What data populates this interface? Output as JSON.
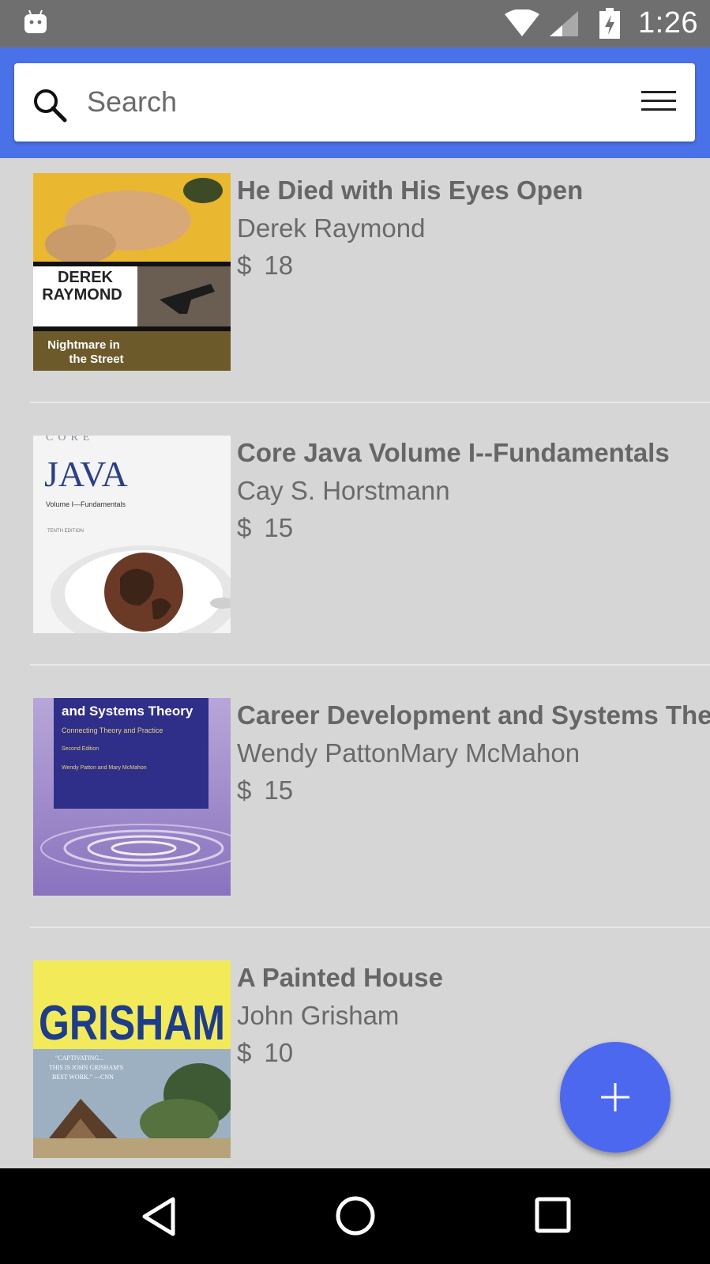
{
  "status_bar": {
    "time": "1:26",
    "icons": [
      "android-icon",
      "wifi-icon",
      "cell-signal-icon",
      "battery-charging-icon"
    ]
  },
  "search": {
    "placeholder": "Search",
    "value": ""
  },
  "books": [
    {
      "title": "He Died with His Eyes Open",
      "author": "Derek Raymond",
      "currency": "$",
      "price": "18",
      "cover": {
        "line1": "DEREK",
        "line2": "RAYMOND",
        "line3": "Nightmare in",
        "line4": "the Street"
      }
    },
    {
      "title": "Core Java Volume I--Fundamentals",
      "author": "Cay S. Horstmann",
      "currency": "$",
      "price": "15",
      "cover": {
        "line1": "CORE",
        "line2": "JAVA",
        "line3": "Volume I—Fundamentals",
        "line4": "TENTH EDITION"
      }
    },
    {
      "title": "Career Development and Systems Theory",
      "author": "Wendy PattonMary McMahon",
      "currency": "$",
      "price": "15",
      "cover": {
        "line1": "and Systems Theory",
        "line2": "Connecting Theory and Practice",
        "line3": "Second Edition",
        "line4": "Wendy Patton and Mary McMahon"
      }
    },
    {
      "title": "A Painted House",
      "author": "John Grisham",
      "currency": "$",
      "price": "10",
      "cover": {
        "line1": "GRISHAM",
        "line2": "\"CAPTIVATING...",
        "line3": "THIS IS JOHN GRISHAM'S",
        "line4": "BEST WORK.\" —CNN"
      }
    }
  ],
  "colors": {
    "header": "#4a72e8",
    "fab": "#4b68ee",
    "list_background": "#d6d6d6",
    "status_bar": "#6f6f6f"
  }
}
